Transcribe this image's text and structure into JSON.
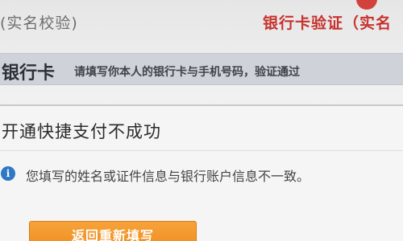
{
  "steps": {
    "previous": "(实名校验)",
    "current": "银行卡验证（实名"
  },
  "section": {
    "title": "银行卡",
    "description": "请填写你本人的银行卡与手机号码，验证通过"
  },
  "result": {
    "title": "开通快捷支付不成功",
    "info_icon_glyph": "i",
    "message": "您填写的姓名或证件信息与银行账户信息不一致。",
    "return_button": "返回重新填写"
  },
  "colors": {
    "accent_red": "#c7322d",
    "button_orange": "#ee8a1e",
    "info_blue": "#2f78c4"
  }
}
